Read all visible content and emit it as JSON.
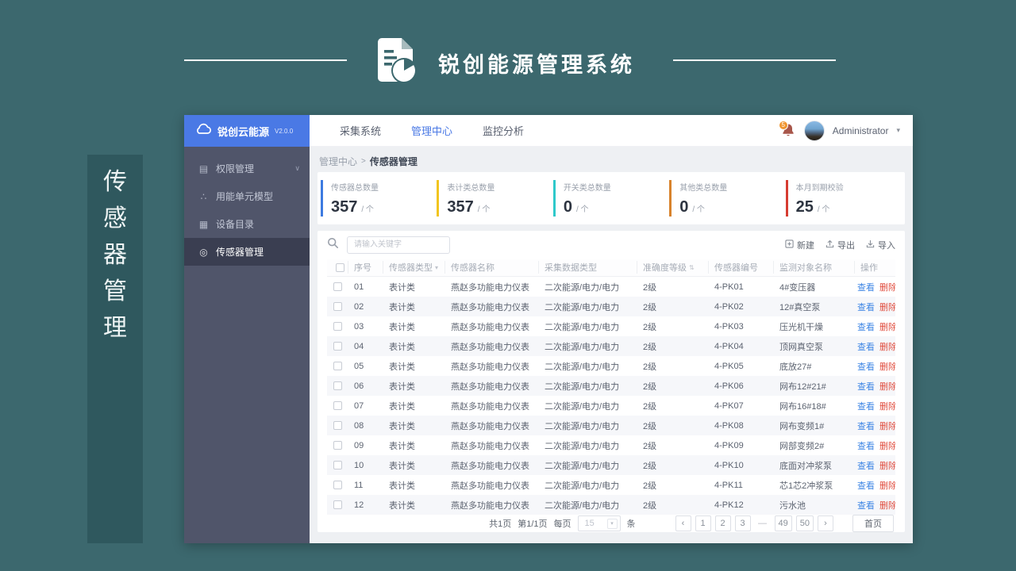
{
  "banner": {
    "title": "锐创能源管理系统"
  },
  "side_tab": {
    "label": "传感器管理",
    "chars": [
      "传",
      "感",
      "器",
      "管",
      "理"
    ]
  },
  "window": {
    "logo": {
      "name": "锐创云能源",
      "version": "V2.0.0"
    },
    "topnav": {
      "items": [
        {
          "label": "采集系统",
          "active": false
        },
        {
          "label": "管理中心",
          "active": true
        },
        {
          "label": "监控分析",
          "active": false
        }
      ],
      "user": {
        "name": "Administrator",
        "badge": "5"
      }
    },
    "sidebar": {
      "items": [
        {
          "label": "权限管理",
          "glyph": "▤",
          "chevron": "∨",
          "active": false
        },
        {
          "label": "用能单元模型",
          "glyph": "∴",
          "active": false
        },
        {
          "label": "设备目录",
          "glyph": "▦",
          "active": false
        },
        {
          "label": "传感器管理",
          "glyph": "◎",
          "active": true
        }
      ]
    },
    "breadcrumb": {
      "parent": "管理中心",
      "separator": ">",
      "current": "传感器管理"
    },
    "stats": [
      {
        "label": "传感器总数量",
        "value": "357",
        "unit": "/ 个",
        "color": "#3d7be0"
      },
      {
        "label": "表计类总数量",
        "value": "357",
        "unit": "/ 个",
        "color": "#f2c51f"
      },
      {
        "label": "开关类总数量",
        "value": "0",
        "unit": "/ 个",
        "color": "#2ec8ca"
      },
      {
        "label": "其他类总数量",
        "value": "0",
        "unit": "/ 个",
        "color": "#d8832c"
      },
      {
        "label": "本月到期校验",
        "value": "25",
        "unit": "/ 个",
        "color": "#d63c31"
      }
    ],
    "toolbar": {
      "search_placeholder": "请输入关键字",
      "buttons": [
        {
          "label": "新建"
        },
        {
          "label": "导出"
        },
        {
          "label": "导入"
        }
      ]
    },
    "table": {
      "columns": [
        {
          "label": "序号"
        },
        {
          "label": "传感器类型",
          "glyph": "▾"
        },
        {
          "label": "传感器名称"
        },
        {
          "label": "采集数据类型"
        },
        {
          "label": "准确度等级",
          "glyph": "⇅"
        },
        {
          "label": "传感器编号"
        },
        {
          "label": "监测对象名称"
        },
        {
          "label": "操作"
        }
      ],
      "actions": {
        "view": "查看",
        "delete": "删除"
      },
      "rows": [
        {
          "no": "01",
          "type": "表计类",
          "name": "燕赵多功能电力仪表",
          "data_type": "二次能源/电力/电力",
          "accuracy": "2级",
          "code": "4-PK01",
          "target": "4#变压器"
        },
        {
          "no": "02",
          "type": "表计类",
          "name": "燕赵多功能电力仪表",
          "data_type": "二次能源/电力/电力",
          "accuracy": "2级",
          "code": "4-PK02",
          "target": "12#真空泵"
        },
        {
          "no": "03",
          "type": "表计类",
          "name": "燕赵多功能电力仪表",
          "data_type": "二次能源/电力/电力",
          "accuracy": "2级",
          "code": "4-PK03",
          "target": "压光机干燥"
        },
        {
          "no": "04",
          "type": "表计类",
          "name": "燕赵多功能电力仪表",
          "data_type": "二次能源/电力/电力",
          "accuracy": "2级",
          "code": "4-PK04",
          "target": "顶网真空泵"
        },
        {
          "no": "05",
          "type": "表计类",
          "name": "燕赵多功能电力仪表",
          "data_type": "二次能源/电力/电力",
          "accuracy": "2级",
          "code": "4-PK05",
          "target": "底放27#"
        },
        {
          "no": "06",
          "type": "表计类",
          "name": "燕赵多功能电力仪表",
          "data_type": "二次能源/电力/电力",
          "accuracy": "2级",
          "code": "4-PK06",
          "target": "网布12#21#"
        },
        {
          "no": "07",
          "type": "表计类",
          "name": "燕赵多功能电力仪表",
          "data_type": "二次能源/电力/电力",
          "accuracy": "2级",
          "code": "4-PK07",
          "target": "网布16#18#"
        },
        {
          "no": "08",
          "type": "表计类",
          "name": "燕赵多功能电力仪表",
          "data_type": "二次能源/电力/电力",
          "accuracy": "2级",
          "code": "4-PK08",
          "target": "网布变频1#"
        },
        {
          "no": "09",
          "type": "表计类",
          "name": "燕赵多功能电力仪表",
          "data_type": "二次能源/电力/电力",
          "accuracy": "2级",
          "code": "4-PK09",
          "target": "网部变频2#"
        },
        {
          "no": "10",
          "type": "表计类",
          "name": "燕赵多功能电力仪表",
          "data_type": "二次能源/电力/电力",
          "accuracy": "2级",
          "code": "4-PK10",
          "target": "底面对冲浆泵"
        },
        {
          "no": "11",
          "type": "表计类",
          "name": "燕赵多功能电力仪表",
          "data_type": "二次能源/电力/电力",
          "accuracy": "2级",
          "code": "4-PK11",
          "target": "芯1芯2冲浆泵"
        },
        {
          "no": "12",
          "type": "表计类",
          "name": "燕赵多功能电力仪表",
          "data_type": "二次能源/电力/电力",
          "accuracy": "2级",
          "code": "4-PK12",
          "target": "污水池"
        }
      ]
    },
    "pagination": {
      "total_pages": "共1页",
      "current": "第1/1页",
      "per_page_label": "每页",
      "per_page_value": "15",
      "per_page_chevron": "▾",
      "unit_label": "条",
      "pages": [
        {
          "label": "‹",
          "kind": "nav"
        },
        {
          "label": "1"
        },
        {
          "label": "2"
        },
        {
          "label": "3"
        },
        {
          "label": "—",
          "kind": "gap"
        },
        {
          "label": "49"
        },
        {
          "label": "50"
        },
        {
          "label": "›",
          "kind": "nav"
        }
      ],
      "first_page": "首页"
    }
  }
}
